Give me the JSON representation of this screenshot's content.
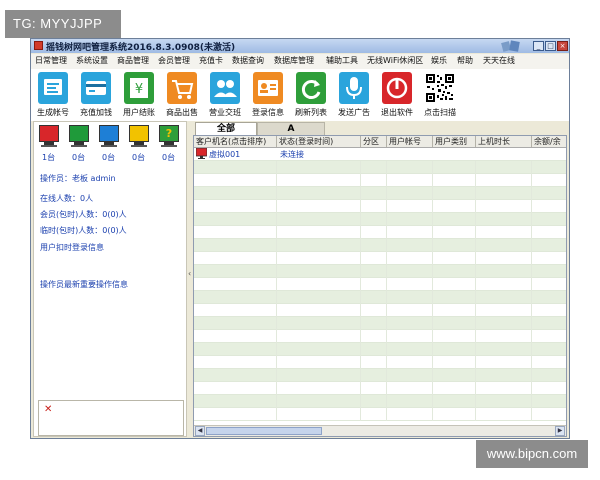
{
  "watermark_top": "TG: MYYJJPP",
  "watermark_bottom": "www.bipcn.com",
  "window": {
    "title": "摇钱树网吧管理系统2016.8.3.0908(未激活)",
    "min_label": "_",
    "max_label": "□",
    "close_label": "×"
  },
  "menu": [
    "日常管理",
    "系统设置",
    "商品管理",
    "会员管理",
    "充值卡",
    "数据查询",
    "数据库管理",
    "辅助工具",
    "无线WiFi休闲区",
    "娱乐",
    "帮助",
    "天天在线"
  ],
  "toolbar": [
    {
      "label": "生成帐号",
      "icon": "generate-account-icon",
      "color": "#2aa4dc"
    },
    {
      "label": "充值加钱",
      "icon": "recharge-icon",
      "color": "#2aa4dc"
    },
    {
      "label": "用户结账",
      "icon": "checkout-icon",
      "color": "#2e9e3a"
    },
    {
      "label": "商品出售",
      "icon": "shopping-cart-icon",
      "color": "#ef8a22"
    },
    {
      "label": "营业交班",
      "icon": "shift-handover-icon",
      "color": "#2aa4dc"
    },
    {
      "label": "登录信息",
      "icon": "login-info-icon",
      "color": "#ef8a22"
    },
    {
      "label": "刷新列表",
      "icon": "refresh-icon",
      "color": "#2e9e3a"
    },
    {
      "label": "发送广告",
      "icon": "microphone-icon",
      "color": "#2aa4dc"
    },
    {
      "label": "退出软件",
      "icon": "power-icon",
      "color": "#d8262a"
    },
    {
      "label": "点击扫描",
      "icon": "qr-code-icon",
      "color": "#000000"
    }
  ],
  "left": {
    "monitors": [
      {
        "count": "1台",
        "color": "#d8262a",
        "icon": "monitor-red-icon"
      },
      {
        "count": "0台",
        "color": "#1f9a3a",
        "icon": "monitor-green-icon"
      },
      {
        "count": "0台",
        "color": "#1e7fd6",
        "icon": "monitor-blue-icon"
      },
      {
        "count": "0台",
        "color": "#f2c200",
        "icon": "monitor-yellow-icon"
      },
      {
        "count": "0台",
        "color": "#2e9e3a",
        "icon": "monitor-unknown-icon",
        "symbol": "?"
      }
    ],
    "operator_label": "操作员：",
    "operator_value": "老板 admin",
    "online_users": "在线人数：0人",
    "member_users": "会员(包时)人数：0(0)人",
    "temp_users": "临时(包时)人数：0(0)人",
    "login_info_link": "用户扣时登录信息",
    "recent_ops": "操作员最新重要操作信息"
  },
  "tabs": [
    "全部",
    "A"
  ],
  "table": {
    "columns": [
      "客户机名(点击排序)",
      "状态(登录时间)",
      "分区",
      "用户帐号",
      "用户类别",
      "上机时长",
      "余额/余"
    ],
    "rows": [
      {
        "name": "虚拟001",
        "status": "未连接"
      }
    ]
  },
  "colors": {
    "window_bg": "#ece9d8",
    "row_band": "#e6efdf",
    "link_text": "#1a3fae"
  }
}
